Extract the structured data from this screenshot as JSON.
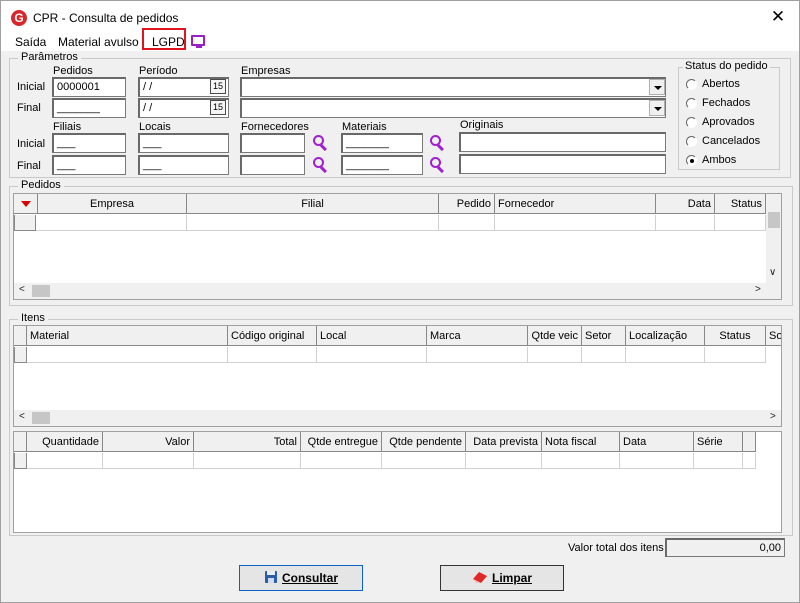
{
  "window": {
    "title": "CPR - Consulta de pedidos",
    "close_glyph": "✕",
    "app_icon_letter": "G"
  },
  "menu": {
    "items": [
      "Saída",
      "Material avulso",
      "LGPD"
    ],
    "highlight_color": "#e0141e",
    "icon_name": "monitor-icon"
  },
  "params": {
    "legend": "Parâmetros",
    "row_labels": {
      "inicial": "Inicial",
      "final": "Final"
    },
    "pedidos": {
      "label": "Pedidos",
      "inicial": "0000001",
      "final": "_______"
    },
    "periodo": {
      "label": "Período",
      "inicial": " / /",
      "final": " / /",
      "cal_glyph": "15"
    },
    "empresas": {
      "label": "Empresas",
      "inicial": "",
      "final": ""
    },
    "filiais": {
      "label": "Filiais",
      "inicial": "___",
      "final": "___"
    },
    "locais": {
      "label": "Locais",
      "inicial": "___",
      "final": "___"
    },
    "fornecedores": {
      "label": "Fornecedores",
      "inicial": "",
      "final": ""
    },
    "materiais": {
      "label": "Materiais",
      "inicial": "_______",
      "final": "_______"
    },
    "originais": {
      "label": "Originais",
      "inicial": "",
      "final": ""
    }
  },
  "status": {
    "legend": "Status do pedido",
    "options": [
      "Abertos",
      "Fechados",
      "Aprovados",
      "Cancelados",
      "Ambos"
    ],
    "selected": "Ambos"
  },
  "pedidos_grid": {
    "legend": "Pedidos",
    "columns": [
      "Empresa",
      "Filial",
      "Pedido",
      "Fornecedor",
      "Data",
      "Status"
    ]
  },
  "itens_grid": {
    "legend": "Itens",
    "columns": [
      "Material",
      "Código original",
      "Local",
      "Marca",
      "Qtde veic",
      "Setor",
      "Localização",
      "Status",
      "So"
    ]
  },
  "detail_grid": {
    "columns": [
      "Quantidade",
      "Valor",
      "Total",
      "Qtde entregue",
      "Qtde pendente",
      "Data prevista",
      "Nota fiscal",
      "Data",
      "Série"
    ]
  },
  "footer": {
    "total_label": "Valor total dos itens",
    "total_value": "0,00"
  },
  "buttons": {
    "consultar": "Consultar",
    "limpar": "Limpar"
  },
  "colors": {
    "accent": "#a020d0",
    "button_border": "#0a62c8",
    "sort_arrow": "#dd0000"
  }
}
